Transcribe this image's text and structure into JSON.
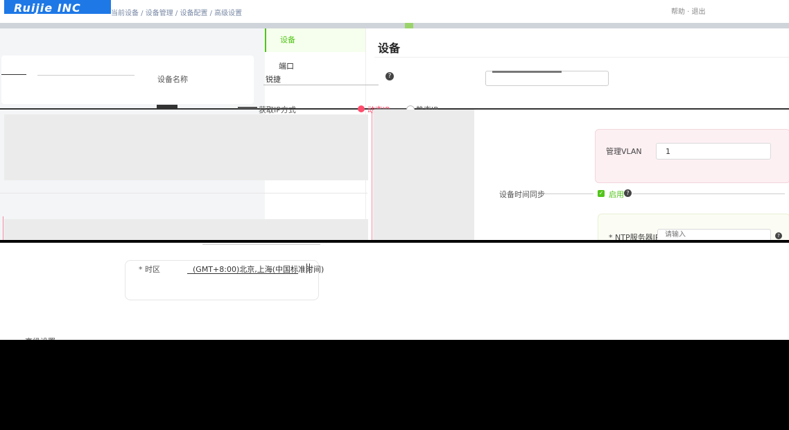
{
  "header": {
    "logo": "Ruijie INC",
    "breadcrumb": "当前设备 / 设备管理 / 设备配置 / 高级设置",
    "right_text": "帮助 · 退出"
  },
  "menu": {
    "items": [
      {
        "label": "设备"
      },
      {
        "label": "端口"
      }
    ]
  },
  "main": {
    "title": "设备",
    "device_name_label": "设备名称",
    "device_name_value": "锐捷",
    "ip_mode_label": "获取IP方式",
    "ip_mode_dynamic": "动态IP",
    "ip_mode_static": "静态IP",
    "mgmt_vlan_label": "管理VLAN",
    "mgmt_vlan_value": "1",
    "time_sync_label": "设备时间同步",
    "time_sync_enable": "启用",
    "ntp_label": "* NTP服务器IP",
    "ntp_placeholder": "请输入",
    "timezone_label": "* 时区",
    "timezone_value": "(GMT+8:00)北京,上海(中国标准时间)",
    "advanced_label": "高级设置"
  },
  "icons": {
    "help": "help-icon",
    "check": "checkbox-checked-icon"
  },
  "colors": {
    "accent_green": "#52c41a",
    "radio_active": "#ff4d6d",
    "logo_blue": "#1e78e6"
  }
}
